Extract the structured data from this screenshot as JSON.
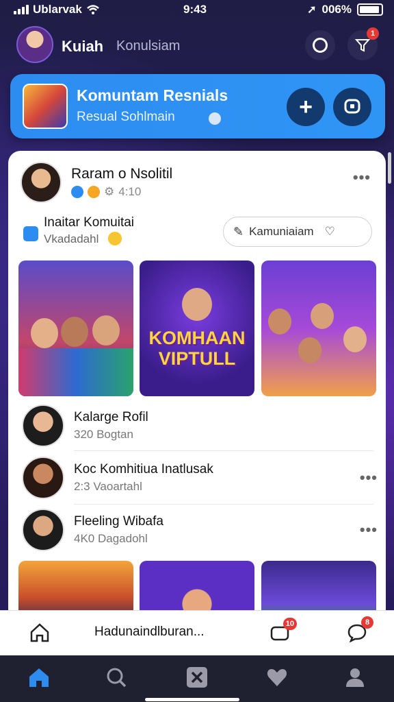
{
  "status": {
    "carrier": "Ublarvak",
    "time": "9:43",
    "battery": "006%"
  },
  "header": {
    "name": "Kuiah",
    "subtitle": "Konulsiam",
    "notif_badge": "1"
  },
  "banner": {
    "title": "Komuntam Resnials",
    "subtitle": "Resual Sohlmain"
  },
  "post": {
    "author": "Raram o Nsolitil",
    "time": "4:10",
    "invite_title": "Inaitar Komuitai",
    "invite_sub": "Vkadadahl",
    "pill_label": "Kamuniaiam",
    "tile_caption": "KOMHAAN VIPTULL"
  },
  "list": [
    {
      "name": "Kalarge Rofil",
      "count": "320 Bogtan"
    },
    {
      "name": "Koc Komhitiua Inatlusak",
      "count": "2:3 Vaoartahl"
    },
    {
      "name": "Fleeling Wibafa",
      "count": "4K0 Dagadohl"
    }
  ],
  "strip": {
    "text": "Hadunaindlburan...",
    "badge_1": "10",
    "badge_2": "8"
  },
  "colors": {
    "accent": "#2d8cf0",
    "nav_active": "#2d8cf0",
    "badge": "#e53935"
  }
}
